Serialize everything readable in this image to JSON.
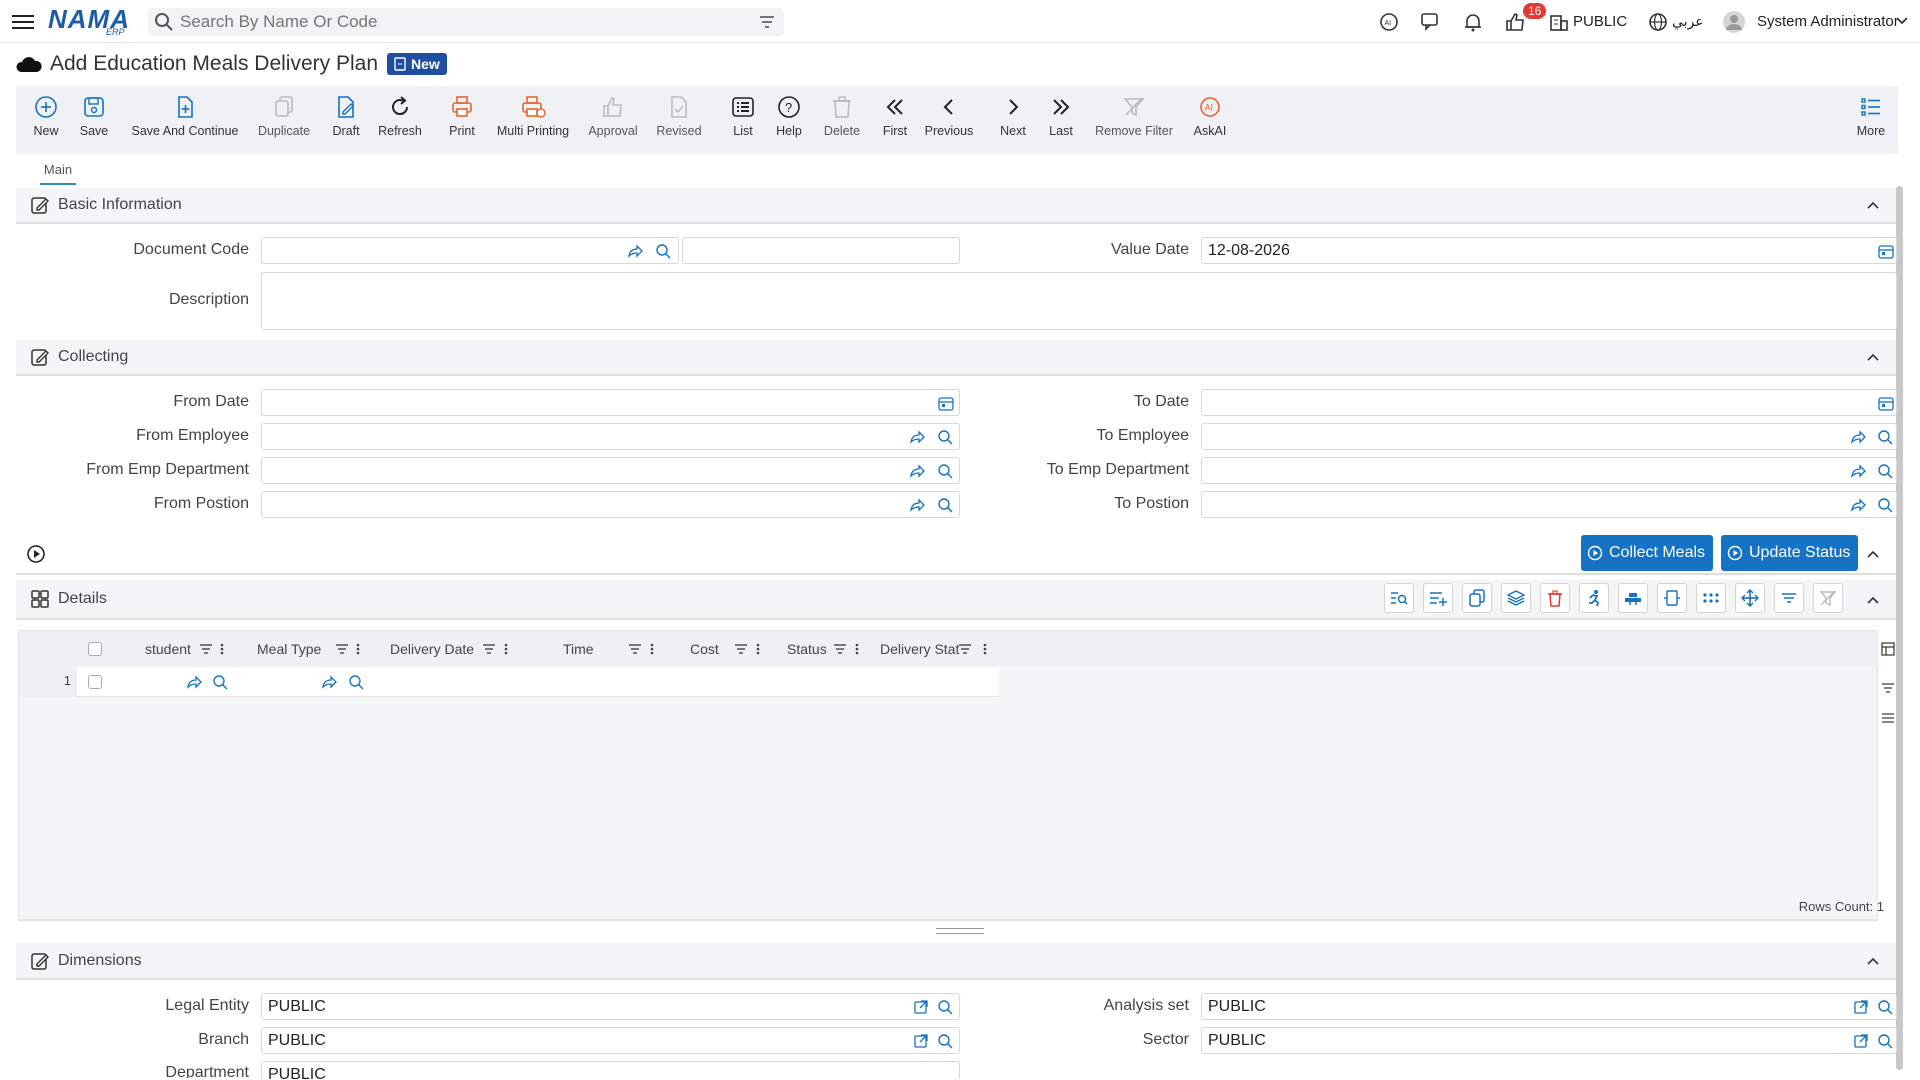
{
  "app": {
    "logo_text": "NAMA",
    "logo_sub": "ERP",
    "search_placeholder": "Search By Name Or Code",
    "notification_count": "16",
    "company": "PUBLIC",
    "language": "عربي",
    "user": "System Administrator"
  },
  "page": {
    "title": "Add Education Meals Delivery Plan",
    "status_badge": "New"
  },
  "toolbar": {
    "new": "New",
    "save": "Save",
    "save_continue": "Save And Continue",
    "duplicate": "Duplicate",
    "draft": "Draft",
    "refresh": "Refresh",
    "print": "Print",
    "multi_printing": "Multi Printing",
    "approval": "Approval",
    "revised": "Revised",
    "list": "List",
    "help": "Help",
    "delete": "Delete",
    "first": "First",
    "previous": "Previous",
    "next": "Next",
    "last": "Last",
    "remove_filter": "Remove Filter",
    "askai": "AskAI",
    "more": "More"
  },
  "tabs": {
    "main": "Main"
  },
  "basic_info": {
    "title": "Basic Information",
    "document_code_label": "Document Code",
    "document_code_value": "",
    "value_date_label": "Value Date",
    "value_date_value": "12-08-2026",
    "description_label": "Description",
    "description_value": ""
  },
  "collecting": {
    "title": "Collecting",
    "from_date": "From Date",
    "to_date": "To Date",
    "from_employee": "From Employee",
    "to_employee": "To Employee",
    "from_emp_department": "From Emp Department",
    "to_emp_department": "To Emp Department",
    "from_position": "From Postion",
    "to_position": "To Postion"
  },
  "actions": {
    "collect_meals": "Collect Meals",
    "update_status": "Update Status"
  },
  "details": {
    "title": "Details",
    "columns": [
      "student",
      "Meal Type",
      "Delivery Date",
      "Time",
      "Cost",
      "Status",
      "Delivery Stat"
    ],
    "row_number": "1",
    "rows_count": "Rows Count: 1"
  },
  "dimensions": {
    "title": "Dimensions",
    "legal_entity_label": "Legal Entity",
    "legal_entity_value": "PUBLIC",
    "analysis_set_label": "Analysis set",
    "analysis_set_value": "PUBLIC",
    "branch_label": "Branch",
    "branch_value": "PUBLIC",
    "sector_label": "Sector",
    "sector_value": "PUBLIC",
    "department_label": "Department",
    "department_value": "PUBLIC"
  },
  "colors": {
    "accent": "#1572c4",
    "brand": "#1e5ca8",
    "print_orange": "#e8642c",
    "badge_red": "#e53935"
  }
}
